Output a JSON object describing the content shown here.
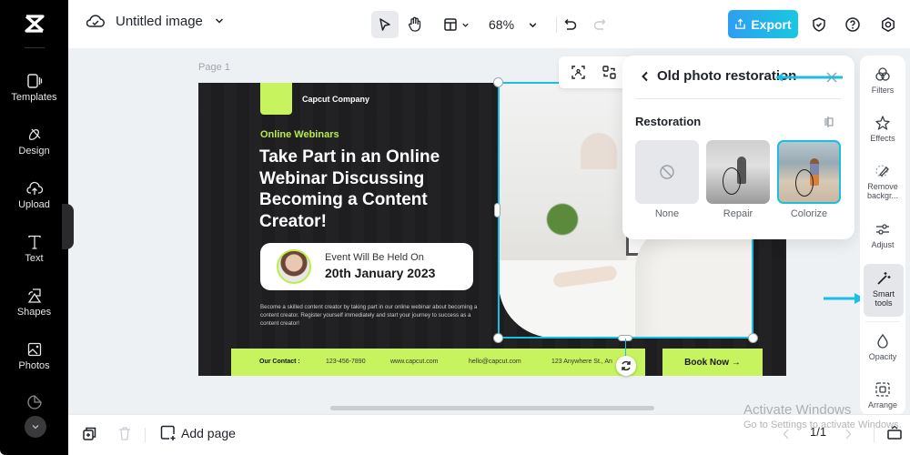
{
  "app": {
    "logo": "capcut-logo",
    "document_title": "Untitled image"
  },
  "toolbar": {
    "zoom": "68%",
    "export_label": "Export",
    "accent": "#1fb4ea"
  },
  "sidebar": {
    "items": [
      {
        "label": "Templates",
        "icon": "templates-icon"
      },
      {
        "label": "Design",
        "icon": "design-icon"
      },
      {
        "label": "Upload",
        "icon": "upload-icon"
      },
      {
        "label": "Text",
        "icon": "text-icon"
      },
      {
        "label": "Shapes",
        "icon": "shapes-icon"
      },
      {
        "label": "Photos",
        "icon": "photos-icon"
      },
      {
        "label": "Stickers",
        "icon": "stickers-icon"
      }
    ]
  },
  "canvas": {
    "page_label": "Page 1",
    "design": {
      "company": "Capcut Company",
      "tagline": "Online Webinars",
      "headline": "Take Part in an Online Webinar Discussing Becoming a Content Creator!",
      "event_line1": "Event Will Be Held On",
      "event_line2": "20th January 2023",
      "description": "Become a skilled content creator by taking part in our online webinar about becoming a content creator. Register yourself immediately and start your journey to success as a content creator!",
      "contact_label": "Our Contact :",
      "phone": "123-456-7890",
      "website": "www.capcut.com",
      "email": "hello@capcut.com",
      "address": "123 Anywhere St., An",
      "book_now": "Book Now →",
      "lime": "#c6f35e"
    }
  },
  "panel": {
    "title": "Old photo restoration",
    "section": "Restoration",
    "options": [
      {
        "label": "None",
        "selected": false
      },
      {
        "label": "Repair",
        "selected": false
      },
      {
        "label": "Colorize",
        "selected": true
      }
    ]
  },
  "rightbar": {
    "items": [
      {
        "label": "Filters"
      },
      {
        "label": "Effects"
      },
      {
        "label": "Remove backgr..."
      },
      {
        "label": "Adjust"
      },
      {
        "label": "Smart tools",
        "active": true
      },
      {
        "label": "Opacity"
      },
      {
        "label": "Arrange"
      }
    ]
  },
  "bottombar": {
    "add_page": "Add page",
    "page_count": "1/1"
  },
  "watermark": {
    "line1": "Activate Windows",
    "line2": "Go to Settings to activate Windows."
  }
}
